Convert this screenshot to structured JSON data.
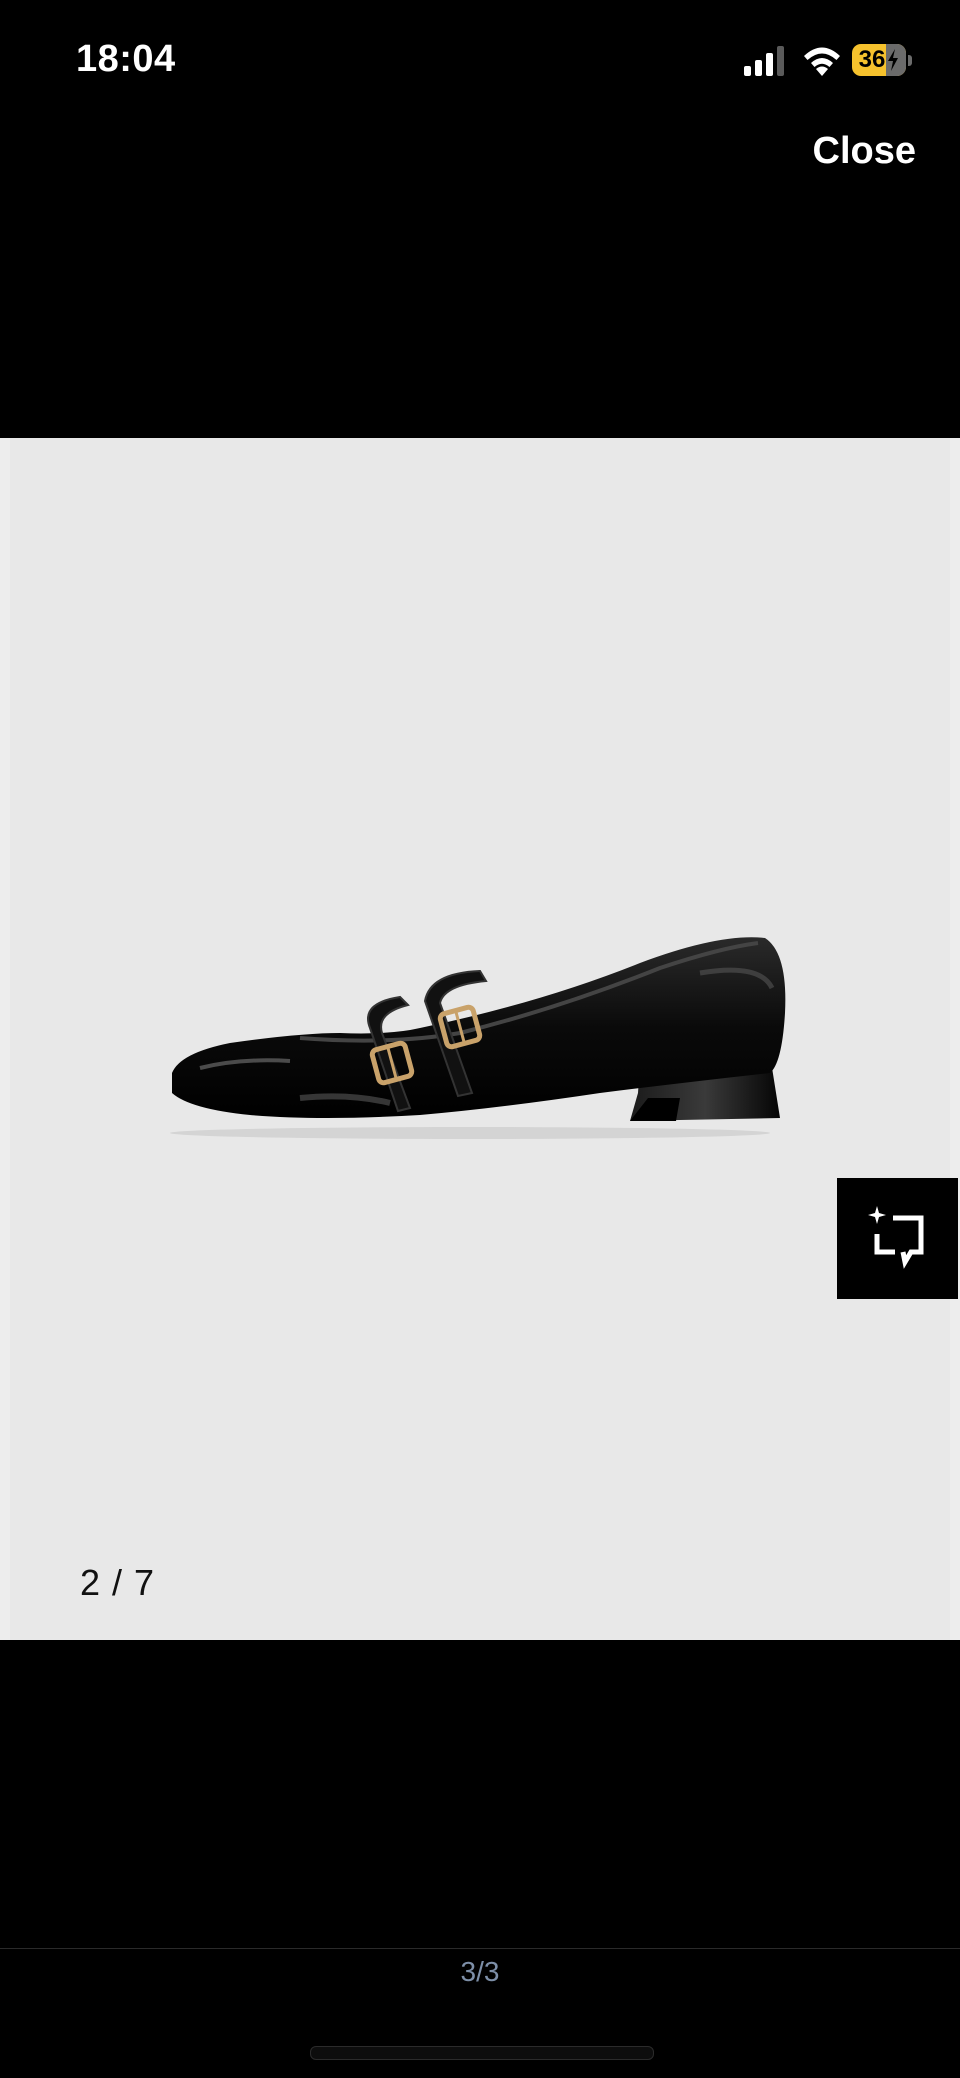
{
  "status_bar": {
    "time": "18:04",
    "battery_level": "36",
    "signal_icon": "cellular-signal-icon",
    "wifi_icon": "wifi-icon",
    "battery_icon": "battery-charging-icon"
  },
  "header": {
    "close_label": "Close"
  },
  "viewer": {
    "image_description": "black patent leather mary-jane flat with two buckle straps",
    "page_counter": "2 / 7",
    "visual_search_icon": "visual-search-icon"
  },
  "footer": {
    "page_indicator": "3/3"
  },
  "colors": {
    "background": "#000000",
    "image_background": "#e8e8e8",
    "battery": "#f6c22d",
    "indicator_text": "#7d8fa8"
  }
}
